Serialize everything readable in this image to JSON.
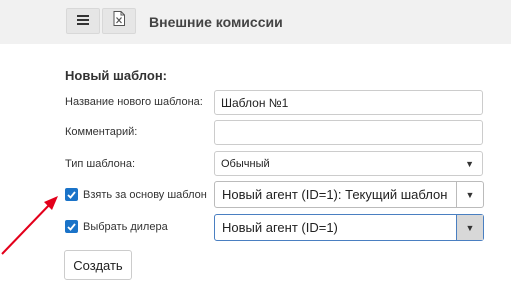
{
  "header": {
    "title": "Внешние комиссии",
    "menu_icon": "hamburger-menu-icon",
    "excel_icon": "excel-export-icon"
  },
  "form": {
    "section_title": "Новый шаблон:",
    "name_label": "Название нового шаблона:",
    "name_value": "Шаблон №1",
    "comment_label": "Комментарий:",
    "comment_value": "",
    "type_label": "Тип шаблона:",
    "type_value": "Обычный",
    "base_template_checkbox_checked": true,
    "base_template_label": "Взять за основу шаблон",
    "base_template_value": "Новый агент (ID=1): Текущий шаблон",
    "dealer_checkbox_checked": true,
    "dealer_label": "Выбрать дилера",
    "dealer_value": "Новый агент (ID=1)",
    "create_label": "Создать"
  },
  "colors": {
    "accent": "#1a73c8",
    "annotation_arrow": "#e3001b"
  }
}
